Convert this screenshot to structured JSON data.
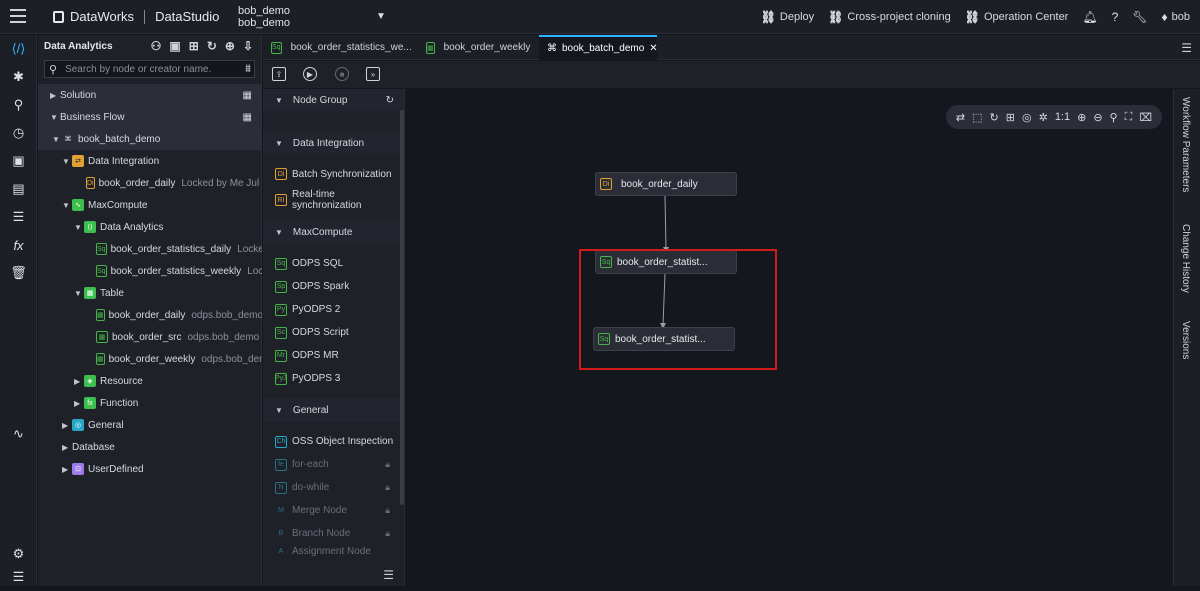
{
  "topbar": {
    "brand": "DataWorks",
    "product": "DataStudio",
    "project_line1": "bob_demo",
    "project_line2": "bob_demo",
    "links": [
      "Deploy",
      "Cross-project cloning",
      "Operation Center"
    ],
    "user": "bob"
  },
  "tree": {
    "title": "Data Analytics",
    "search_placeholder": "Search by node or creator name.",
    "rows": [
      {
        "label": "Solution",
        "sub": ""
      },
      {
        "label": "Business Flow",
        "sub": ""
      },
      {
        "label": "book_batch_demo",
        "sub": ""
      },
      {
        "label": "Data Integration",
        "sub": ""
      },
      {
        "label": "book_order_daily",
        "sub": "Locked by Me   Jul 29"
      },
      {
        "label": "MaxCompute",
        "sub": ""
      },
      {
        "label": "Data Analytics",
        "sub": ""
      },
      {
        "label": "book_order_statistics_daily",
        "sub": "Locked"
      },
      {
        "label": "book_order_statistics_weekly",
        "sub": "Locke"
      },
      {
        "label": "Table",
        "sub": ""
      },
      {
        "label": "book_order_daily",
        "sub": "odps.bob_demo"
      },
      {
        "label": "book_order_src",
        "sub": "odps.bob_demo"
      },
      {
        "label": "book_order_weekly",
        "sub": "odps.bob_demo"
      },
      {
        "label": "Resource",
        "sub": ""
      },
      {
        "label": "Function",
        "sub": ""
      },
      {
        "label": "General",
        "sub": ""
      },
      {
        "label": "Database",
        "sub": ""
      },
      {
        "label": "UserDefined",
        "sub": ""
      }
    ]
  },
  "tabs": [
    "book_order_statistics_we...",
    "book_order_weekly",
    "book_batch_demo"
  ],
  "palette": {
    "node_group": "Node Group",
    "groups": [
      {
        "title": "Data Integration",
        "items": [
          [
            "Di",
            "Batch Synchronization"
          ],
          [
            "RI",
            "Real-time synchronization"
          ]
        ]
      },
      {
        "title": "MaxCompute",
        "items": [
          [
            "Sq",
            "ODPS SQL"
          ],
          [
            "Sp",
            "ODPS Spark"
          ],
          [
            "Py",
            "PyODPS 2"
          ],
          [
            "Sc",
            "ODPS Script"
          ],
          [
            "Mr",
            "ODPS MR"
          ],
          [
            "Py3",
            "PyODPS 3"
          ]
        ]
      },
      {
        "title": "General",
        "items": [
          [
            "Ch",
            "OSS Object Inspection"
          ],
          [
            "fe",
            "for-each"
          ],
          [
            "N",
            "do-while"
          ],
          [
            "M",
            "Merge Node"
          ],
          [
            "B",
            "Branch Node"
          ],
          [
            "A",
            "Assignment Node"
          ]
        ]
      }
    ]
  },
  "canvas": {
    "nodes": [
      {
        "badge": "Di",
        "label": "book_order_daily"
      },
      {
        "badge": "Sq",
        "label": "book_order_statist..."
      },
      {
        "badge": "Sq",
        "label": "book_order_statist..."
      }
    ]
  },
  "right_panel": [
    "Workflow Parameters",
    "Change History",
    "Versions"
  ]
}
